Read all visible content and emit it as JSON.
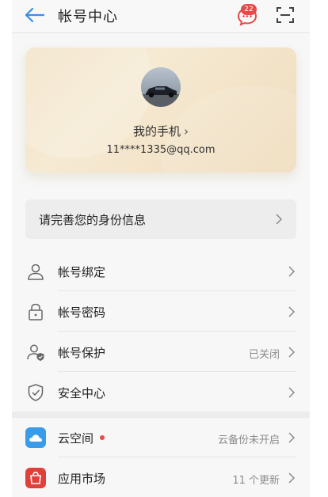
{
  "header": {
    "title": "帐号中心",
    "message_badge": "22"
  },
  "profile": {
    "device_name": "我的手机",
    "email": "11****1335@qq.com"
  },
  "complete_info": {
    "label": "请完善您的身份信息"
  },
  "menu": {
    "items": [
      {
        "label": "帐号绑定",
        "value": "",
        "icon": "user-icon"
      },
      {
        "label": "帐号密码",
        "value": "",
        "icon": "lock-icon"
      },
      {
        "label": "帐号保护",
        "value": "已关闭",
        "icon": "user-shield-icon"
      },
      {
        "label": "安全中心",
        "value": "",
        "icon": "shield-check-icon"
      }
    ]
  },
  "services": {
    "items": [
      {
        "label": "云空间",
        "value": "云备份未开启",
        "icon": "cloud-icon",
        "dot": true
      },
      {
        "label": "应用市场",
        "value": "11 个更新",
        "icon": "app-market-icon"
      }
    ]
  },
  "colors": {
    "accent": "#3a8ee6",
    "badge": "#e84a4a",
    "card_gold": "#f1e2c6"
  }
}
